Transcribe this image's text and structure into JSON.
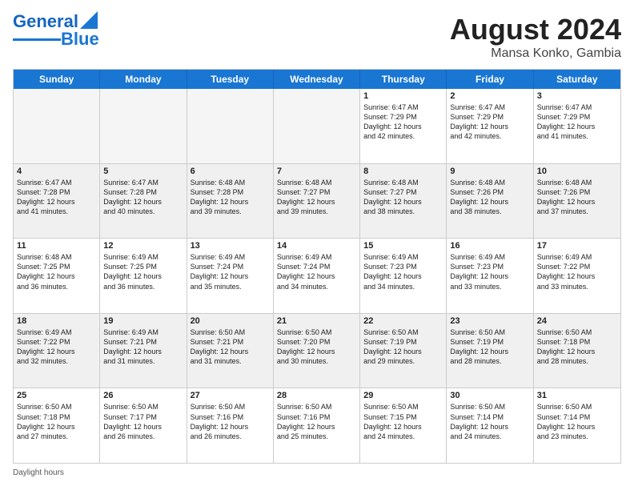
{
  "header": {
    "logo_line1": "General",
    "logo_line2": "Blue",
    "month": "August 2024",
    "location": "Mansa Konko, Gambia"
  },
  "days": [
    "Sunday",
    "Monday",
    "Tuesday",
    "Wednesday",
    "Thursday",
    "Friday",
    "Saturday"
  ],
  "rows": [
    [
      {
        "num": "",
        "text": "",
        "empty": true
      },
      {
        "num": "",
        "text": "",
        "empty": true
      },
      {
        "num": "",
        "text": "",
        "empty": true
      },
      {
        "num": "",
        "text": "",
        "empty": true
      },
      {
        "num": "1",
        "text": "Sunrise: 6:47 AM\nSunset: 7:29 PM\nDaylight: 12 hours\nand 42 minutes.",
        "empty": false
      },
      {
        "num": "2",
        "text": "Sunrise: 6:47 AM\nSunset: 7:29 PM\nDaylight: 12 hours\nand 42 minutes.",
        "empty": false
      },
      {
        "num": "3",
        "text": "Sunrise: 6:47 AM\nSunset: 7:29 PM\nDaylight: 12 hours\nand 41 minutes.",
        "empty": false
      }
    ],
    [
      {
        "num": "4",
        "text": "Sunrise: 6:47 AM\nSunset: 7:28 PM\nDaylight: 12 hours\nand 41 minutes.",
        "empty": false
      },
      {
        "num": "5",
        "text": "Sunrise: 6:47 AM\nSunset: 7:28 PM\nDaylight: 12 hours\nand 40 minutes.",
        "empty": false
      },
      {
        "num": "6",
        "text": "Sunrise: 6:48 AM\nSunset: 7:28 PM\nDaylight: 12 hours\nand 39 minutes.",
        "empty": false
      },
      {
        "num": "7",
        "text": "Sunrise: 6:48 AM\nSunset: 7:27 PM\nDaylight: 12 hours\nand 39 minutes.",
        "empty": false
      },
      {
        "num": "8",
        "text": "Sunrise: 6:48 AM\nSunset: 7:27 PM\nDaylight: 12 hours\nand 38 minutes.",
        "empty": false
      },
      {
        "num": "9",
        "text": "Sunrise: 6:48 AM\nSunset: 7:26 PM\nDaylight: 12 hours\nand 38 minutes.",
        "empty": false
      },
      {
        "num": "10",
        "text": "Sunrise: 6:48 AM\nSunset: 7:26 PM\nDaylight: 12 hours\nand 37 minutes.",
        "empty": false
      }
    ],
    [
      {
        "num": "11",
        "text": "Sunrise: 6:48 AM\nSunset: 7:25 PM\nDaylight: 12 hours\nand 36 minutes.",
        "empty": false
      },
      {
        "num": "12",
        "text": "Sunrise: 6:49 AM\nSunset: 7:25 PM\nDaylight: 12 hours\nand 36 minutes.",
        "empty": false
      },
      {
        "num": "13",
        "text": "Sunrise: 6:49 AM\nSunset: 7:24 PM\nDaylight: 12 hours\nand 35 minutes.",
        "empty": false
      },
      {
        "num": "14",
        "text": "Sunrise: 6:49 AM\nSunset: 7:24 PM\nDaylight: 12 hours\nand 34 minutes.",
        "empty": false
      },
      {
        "num": "15",
        "text": "Sunrise: 6:49 AM\nSunset: 7:23 PM\nDaylight: 12 hours\nand 34 minutes.",
        "empty": false
      },
      {
        "num": "16",
        "text": "Sunrise: 6:49 AM\nSunset: 7:23 PM\nDaylight: 12 hours\nand 33 minutes.",
        "empty": false
      },
      {
        "num": "17",
        "text": "Sunrise: 6:49 AM\nSunset: 7:22 PM\nDaylight: 12 hours\nand 33 minutes.",
        "empty": false
      }
    ],
    [
      {
        "num": "18",
        "text": "Sunrise: 6:49 AM\nSunset: 7:22 PM\nDaylight: 12 hours\nand 32 minutes.",
        "empty": false
      },
      {
        "num": "19",
        "text": "Sunrise: 6:49 AM\nSunset: 7:21 PM\nDaylight: 12 hours\nand 31 minutes.",
        "empty": false
      },
      {
        "num": "20",
        "text": "Sunrise: 6:50 AM\nSunset: 7:21 PM\nDaylight: 12 hours\nand 31 minutes.",
        "empty": false
      },
      {
        "num": "21",
        "text": "Sunrise: 6:50 AM\nSunset: 7:20 PM\nDaylight: 12 hours\nand 30 minutes.",
        "empty": false
      },
      {
        "num": "22",
        "text": "Sunrise: 6:50 AM\nSunset: 7:19 PM\nDaylight: 12 hours\nand 29 minutes.",
        "empty": false
      },
      {
        "num": "23",
        "text": "Sunrise: 6:50 AM\nSunset: 7:19 PM\nDaylight: 12 hours\nand 28 minutes.",
        "empty": false
      },
      {
        "num": "24",
        "text": "Sunrise: 6:50 AM\nSunset: 7:18 PM\nDaylight: 12 hours\nand 28 minutes.",
        "empty": false
      }
    ],
    [
      {
        "num": "25",
        "text": "Sunrise: 6:50 AM\nSunset: 7:18 PM\nDaylight: 12 hours\nand 27 minutes.",
        "empty": false
      },
      {
        "num": "26",
        "text": "Sunrise: 6:50 AM\nSunset: 7:17 PM\nDaylight: 12 hours\nand 26 minutes.",
        "empty": false
      },
      {
        "num": "27",
        "text": "Sunrise: 6:50 AM\nSunset: 7:16 PM\nDaylight: 12 hours\nand 26 minutes.",
        "empty": false
      },
      {
        "num": "28",
        "text": "Sunrise: 6:50 AM\nSunset: 7:16 PM\nDaylight: 12 hours\nand 25 minutes.",
        "empty": false
      },
      {
        "num": "29",
        "text": "Sunrise: 6:50 AM\nSunset: 7:15 PM\nDaylight: 12 hours\nand 24 minutes.",
        "empty": false
      },
      {
        "num": "30",
        "text": "Sunrise: 6:50 AM\nSunset: 7:14 PM\nDaylight: 12 hours\nand 24 minutes.",
        "empty": false
      },
      {
        "num": "31",
        "text": "Sunrise: 6:50 AM\nSunset: 7:14 PM\nDaylight: 12 hours\nand 23 minutes.",
        "empty": false
      }
    ]
  ],
  "footer": {
    "daylight_label": "Daylight hours"
  }
}
